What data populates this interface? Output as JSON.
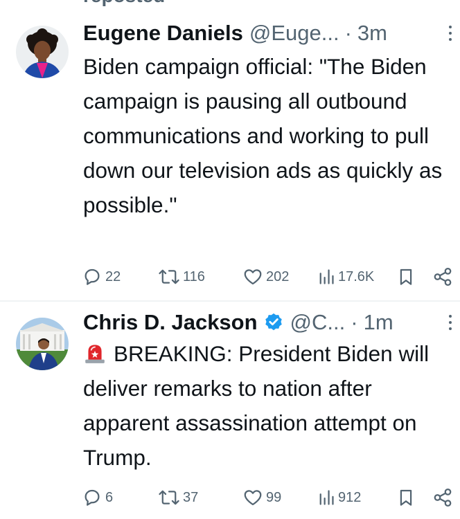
{
  "header": {
    "reposted_label": "reposted"
  },
  "tweets": [
    {
      "display_name": "Eugene Daniels",
      "handle": "@Euge...",
      "separator": "·",
      "time": "3m",
      "verified": false,
      "text": "Biden campaign official: \"The Biden campaign is pausing all outbound communications and working to pull down our television ads as quickly as possible.\"",
      "replies": "22",
      "reposts": "116",
      "likes": "202",
      "views": "17.6K"
    },
    {
      "display_name": "Chris D. Jackson",
      "handle": "@C...",
      "separator": "·",
      "time": "1m",
      "verified": true,
      "emoji_icon": "police-siren-icon",
      "text": "BREAKING: President Biden will deliver remarks to nation after apparent assassination attempt on Trump.",
      "replies": "6",
      "reposts": "37",
      "likes": "99",
      "views": "912"
    }
  ],
  "colors": {
    "text_primary": "#0f1419",
    "text_secondary": "#536471",
    "verified_blue": "#1d9bf0",
    "divider": "#eff3f4",
    "siren_red": "#e0262b"
  }
}
